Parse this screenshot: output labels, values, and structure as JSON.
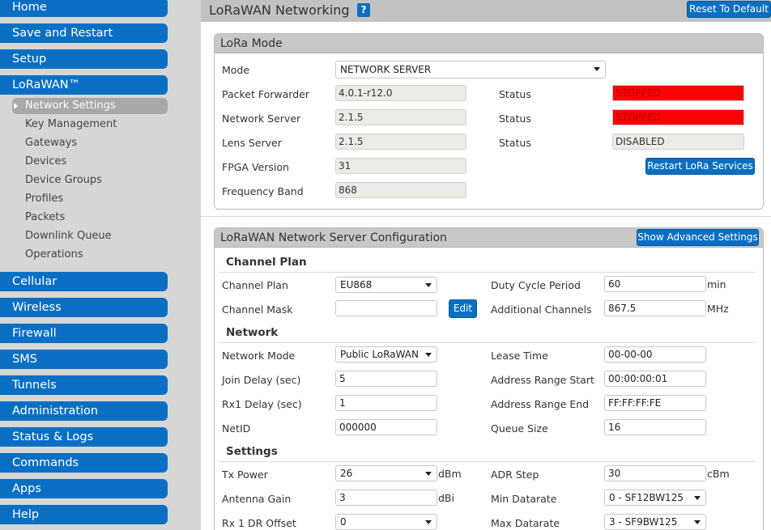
{
  "sidebar": {
    "home": "Home",
    "save_restart": "Save and Restart",
    "setup": "Setup",
    "lorawan": "LoRaWAN™",
    "sub": [
      "Network Settings",
      "Key Management",
      "Gateways",
      "Devices",
      "Device Groups",
      "Profiles",
      "Packets",
      "Downlink Queue",
      "Operations"
    ],
    "cellular": "Cellular",
    "wireless": "Wireless",
    "firewall": "Firewall",
    "sms": "SMS",
    "tunnels": "Tunnels",
    "administration": "Administration",
    "status_logs": "Status & Logs",
    "commands": "Commands",
    "apps": "Apps",
    "help": "Help"
  },
  "header": {
    "title": "LoRaWAN Networking",
    "help": "?",
    "reset": "Reset To Default"
  },
  "lora_mode": {
    "title": "LoRa Mode",
    "mode_label": "Mode",
    "mode_value": "NETWORK SERVER",
    "pf_label": "Packet Forwarder",
    "pf_value": "4.0.1-r12.0",
    "ns_label": "Network Server",
    "ns_value": "2.1.5",
    "lens_label": "Lens Server",
    "lens_value": "2.1.5",
    "fpga_label": "FPGA Version",
    "fpga_value": "31",
    "band_label": "Frequency Band",
    "band_value": "868",
    "status_label": "Status",
    "status_pf": "STOPPED",
    "status_ns": "STOPPED",
    "status_lens": "DISABLED",
    "restart": "Restart LoRa Services"
  },
  "ns_config": {
    "title": "LoRaWAN Network Server Configuration",
    "advanced": "Show Advanced Settings",
    "channel_plan_section": "Channel Plan",
    "channel_plan_label": "Channel Plan",
    "channel_plan_value": "EU868",
    "channel_mask_label": "Channel Mask",
    "channel_mask_value": "",
    "edit": "Edit",
    "duty_label": "Duty Cycle Period",
    "duty_value": "60",
    "duty_unit": "min",
    "addch_label": "Additional Channels",
    "addch_value": "867.5",
    "addch_unit": "MHz",
    "network_section": "Network",
    "netmode_label": "Network Mode",
    "netmode_value": "Public LoRaWAN",
    "join_label": "Join Delay (sec)",
    "join_value": "5",
    "rx1_label": "Rx1 Delay (sec)",
    "rx1_value": "1",
    "netid_label": "NetID",
    "netid_value": "000000",
    "lease_label": "Lease Time",
    "lease_value": "00-00-00",
    "addr_start_label": "Address Range Start",
    "addr_start_value": "00:00:00:01",
    "addr_end_label": "Address Range End",
    "addr_end_value": "FF:FF:FF:FE",
    "queue_label": "Queue Size",
    "queue_value": "16",
    "settings_section": "Settings",
    "txpower_label": "Tx Power",
    "txpower_value": "26",
    "txpower_unit": "dBm",
    "antgain_label": "Antenna Gain",
    "antgain_value": "3",
    "antgain_unit": "dBi",
    "rx1dr_label": "Rx 1 DR Offset",
    "rx1dr_value": "0",
    "adr_label": "ADR Step",
    "adr_value": "30",
    "adr_unit": "cBm",
    "mindr_label": "Min Datarate",
    "mindr_value": "0 - SF12BW125",
    "maxdr_label": "Max Datarate",
    "maxdr_value": "3 - SF9BW125"
  },
  "colors": {
    "accent": "#0a6fc2",
    "stopped": "#ff0000",
    "sidebar_bg": "#d6d6d6"
  }
}
